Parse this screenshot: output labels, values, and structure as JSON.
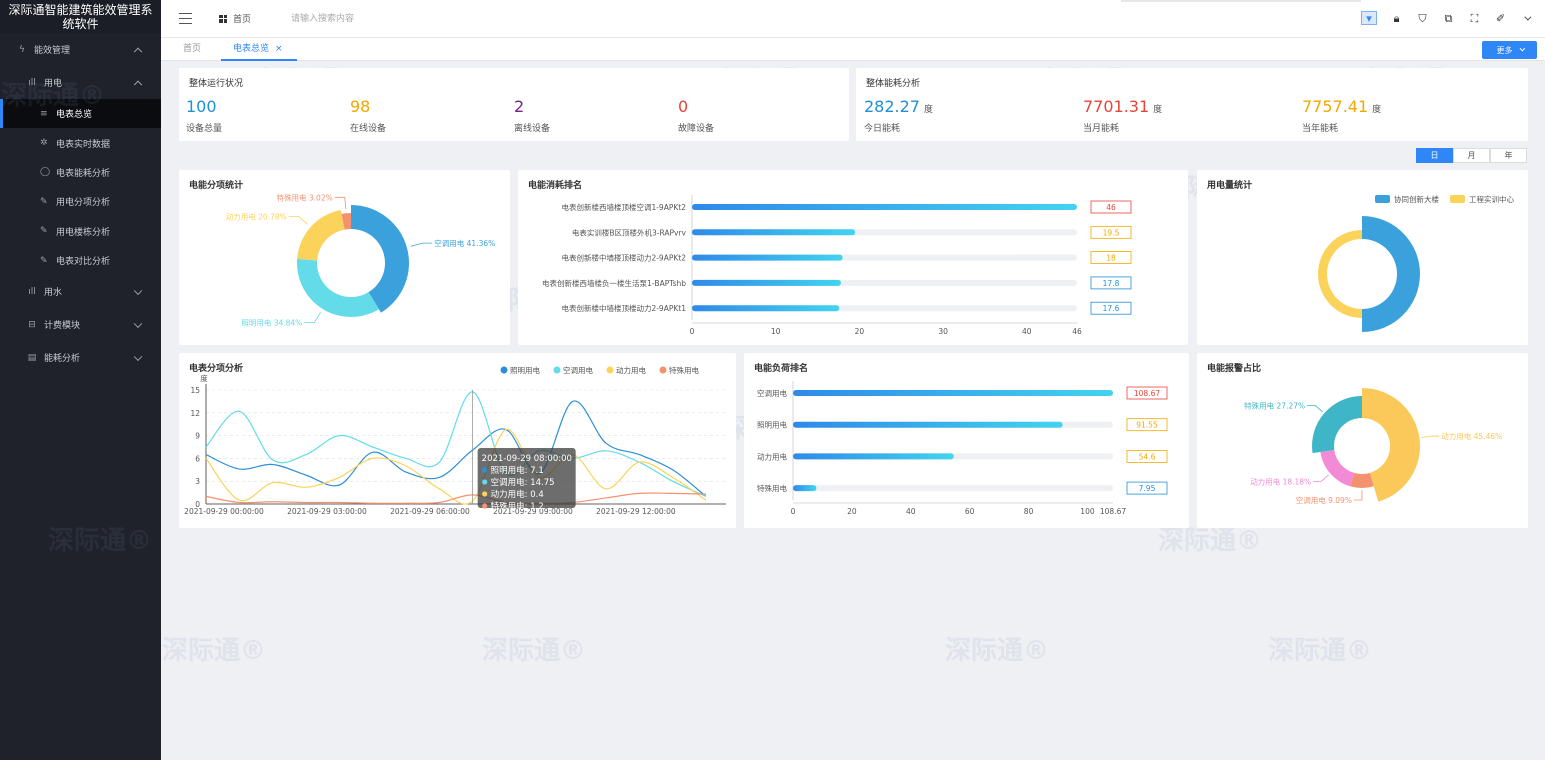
{
  "app": {
    "title": "深际通智能建筑能效管理系统软件"
  },
  "sidebar": {
    "groups": [
      {
        "label": "能效管理",
        "icon": "bolt-icon",
        "state": "expanded"
      },
      {
        "label": "用电",
        "icon": "bar-chart-icon",
        "state": "expanded"
      },
      {
        "label": "用水",
        "icon": "bar-chart-icon",
        "state": "collapsed"
      },
      {
        "label": "计费模块",
        "icon": "billing-icon",
        "state": "collapsed"
      },
      {
        "label": "能耗分析",
        "icon": "document-icon",
        "state": "collapsed"
      }
    ],
    "items": [
      {
        "label": "电表总览",
        "icon": "list-icon",
        "active": true
      },
      {
        "label": "电表实时数据",
        "icon": "gear-icon"
      },
      {
        "label": "电表能耗分析",
        "icon": "circle-icon"
      },
      {
        "label": "用电分项分析",
        "icon": "wrench-icon"
      },
      {
        "label": "用电楼栋分析",
        "icon": "wrench-icon"
      },
      {
        "label": "电表对比分析",
        "icon": "wrench-icon"
      }
    ]
  },
  "header": {
    "breadcrumb": "首页",
    "search_placeholder": "请输入搜索内容",
    "icons": [
      "screen-icon",
      "lock-icon",
      "shirt-icon",
      "translate-icon",
      "fullscreen-icon",
      "brush-icon",
      "chevron-down-icon"
    ]
  },
  "tabs": [
    {
      "label": "首页",
      "active": false
    },
    {
      "label": "电表总览",
      "active": true,
      "closable": true
    }
  ],
  "more_button": "更多",
  "overview": {
    "title": "整体运行状况",
    "stats": [
      {
        "value": "100",
        "label": "设备总量",
        "color": "#1e90d8"
      },
      {
        "value": "98",
        "label": "在线设备",
        "color": "#f2a900"
      },
      {
        "value": "2",
        "label": "离线设备",
        "color": "#7a1f8c"
      },
      {
        "value": "0",
        "label": "故障设备",
        "color": "#e8443a"
      }
    ]
  },
  "energy": {
    "title": "整体能耗分析",
    "stats": [
      {
        "value": "282.27",
        "unit": "度",
        "label": "今日能耗",
        "color": "#1e90d8"
      },
      {
        "value": "7701.31",
        "unit": "度",
        "label": "当月能耗",
        "color": "#e8443a"
      },
      {
        "value": "7757.41",
        "unit": "度",
        "label": "当年能耗",
        "color": "#f2a900"
      }
    ]
  },
  "period_selector": {
    "options": [
      "日",
      "月",
      "年"
    ],
    "selected": "日"
  },
  "watermark_text": "深际通",
  "watermark_mark": "®",
  "chart_data": [
    {
      "id": "subitem-pie",
      "type": "pie",
      "title": "电能分项统计",
      "slices": [
        {
          "name": "空调用电",
          "value": 41.36,
          "label": "空调用电 41.36%",
          "color": "#3ba1dc"
        },
        {
          "name": "照明用电",
          "value": 34.84,
          "label": "照明用电 34.84%",
          "color": "#63dbe8"
        },
        {
          "name": "动力用电",
          "value": 20.78,
          "label": "动力用电 20.78%",
          "color": "#fbd25a"
        },
        {
          "name": "特殊用电",
          "value": 3.02,
          "label": "特殊用电 3.02%",
          "color": "#f4916f"
        }
      ]
    },
    {
      "id": "consumption-ranking",
      "type": "bar",
      "title": "电能消耗排名",
      "categories": [
        "电表创新楼西墙楼顶楼空调1-9APKt2",
        "电表实训楼B区顶楼外机3-RAPvrv",
        "电表创新楼中墙楼顶楼动力2-9APKt2",
        "电表创新楼西墙楼负一楼生活泵1-BAPTshb",
        "电表创新楼中墙楼顶楼动力2-9APKt1"
      ],
      "values": [
        46,
        19.5,
        18,
        17.8,
        17.6
      ],
      "value_labels": [
        "46",
        "19.5",
        "18",
        "17.8",
        "17.6"
      ],
      "badge_colors": [
        "#e8443a",
        "#f2a900",
        "#f2a900",
        "#1e90d8",
        "#1e90d8"
      ],
      "xticks": [
        "0",
        "10",
        "20",
        "30",
        "40",
        "46"
      ],
      "xlim": [
        0,
        46
      ]
    },
    {
      "id": "usage-donut",
      "type": "pie",
      "title": "用电量统计",
      "legend": [
        "协同创新大楼",
        "工程实训中心"
      ],
      "slices": [
        {
          "name": "协同创新大楼",
          "value": 50,
          "color": "#3ba1dc"
        },
        {
          "name": "工程实训中心",
          "value": 50,
          "color": "#fbd25a"
        }
      ]
    },
    {
      "id": "subitem-line",
      "type": "line",
      "title": "电表分项分析",
      "ylabel": "度",
      "yticks": [
        "0",
        "3",
        "6",
        "9",
        "12",
        "15"
      ],
      "ylim": [
        0,
        15
      ],
      "xticks": [
        "2021-09-29 00:00:00",
        "2021-09-29 03:00:00",
        "2021-09-29 06:00:00",
        "2021-09-29 09:00:00",
        "2021-09-29 12:00:00"
      ],
      "x": [
        0,
        1,
        2,
        3,
        4,
        5,
        6,
        7,
        8,
        9,
        10,
        11,
        12,
        13,
        14,
        15
      ],
      "series": [
        {
          "name": "照明用电",
          "color": "#2e8fd6",
          "values": [
            6.5,
            4.6,
            5.2,
            3.8,
            2.5,
            6.8,
            4.2,
            3.5,
            7.1,
            9.8,
            4.0,
            13.5,
            8.0,
            6.5,
            4.5,
            1.0
          ]
        },
        {
          "name": "空调用电",
          "color": "#63dbe8",
          "values": [
            7.5,
            12.2,
            5.8,
            6.5,
            9.0,
            7.5,
            6.0,
            5.5,
            14.75,
            4.0,
            7.0,
            6.0,
            7.0,
            5.5,
            3.0,
            1.0
          ]
        },
        {
          "name": "动力用电",
          "color": "#fbd25a",
          "values": [
            6.0,
            0.5,
            2.8,
            2.2,
            3.5,
            6.0,
            5.0,
            2.0,
            0.4,
            9.8,
            3.5,
            6.5,
            2.0,
            5.5,
            3.5,
            0.5
          ]
        },
        {
          "name": "特殊用电",
          "color": "#f4916f",
          "values": [
            1.0,
            0.2,
            0.3,
            0.2,
            0.2,
            0.1,
            0.1,
            0.2,
            1.2,
            0.2,
            0.1,
            0.2,
            0.8,
            1.4,
            1.4,
            1.3
          ]
        }
      ],
      "tooltip": {
        "time": "2021-09-29 08:00:00",
        "rows": [
          "照明用电: 7.1",
          "空调用电: 14.75",
          "动力用电: 0.4",
          "特殊用电: 1.2"
        ]
      }
    },
    {
      "id": "load-ranking",
      "type": "bar",
      "title": "电能负荷排名",
      "categories": [
        "空调用电",
        "照明用电",
        "动力用电",
        "特殊用电"
      ],
      "values": [
        108.67,
        91.55,
        54.6,
        7.95
      ],
      "value_labels": [
        "108.67",
        "91.55",
        "54.6",
        "7.95"
      ],
      "badge_colors": [
        "#e8443a",
        "#f2a900",
        "#f2a900",
        "#1e90d8"
      ],
      "xticks": [
        "0",
        "20",
        "40",
        "60",
        "80",
        "100",
        "108.67"
      ],
      "xlim": [
        0,
        108.67
      ]
    },
    {
      "id": "alarm-pie",
      "type": "pie",
      "title": "电能报警占比",
      "slices": [
        {
          "name": "动力用电",
          "value": 45.46,
          "label": "动力用电 45.46%",
          "color": "#fbc95a",
          "radius": "large"
        },
        {
          "name": "空调用电",
          "value": 9.09,
          "label": "空调用电 9.09%",
          "color": "#f4916f",
          "radius": "small"
        },
        {
          "name": "动力用电",
          "value": 18.18,
          "label": "动力用电 18.18%",
          "color": "#f38ad6",
          "radius": "small"
        },
        {
          "name": "特殊用电",
          "value": 27.27,
          "label": "特殊用电 27.27%",
          "color": "#3fb5c8",
          "radius": "medium"
        }
      ]
    }
  ]
}
